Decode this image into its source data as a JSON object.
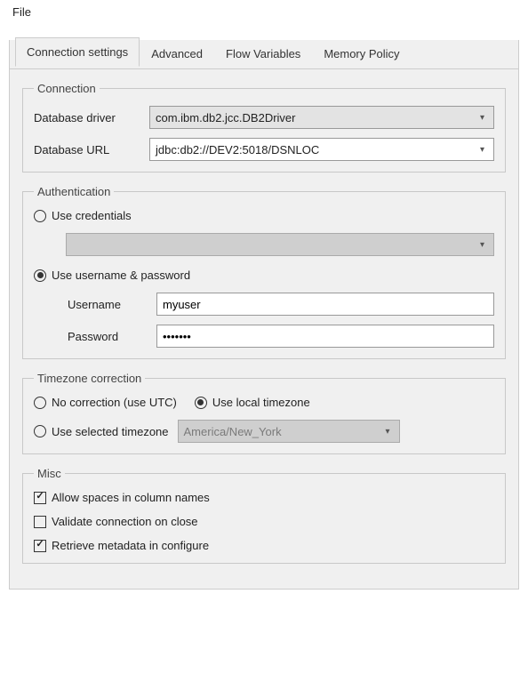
{
  "menu": {
    "file": "File"
  },
  "tabs": {
    "connection_settings": "Connection settings",
    "advanced": "Advanced",
    "flow_variables": "Flow Variables",
    "memory_policy": "Memory Policy"
  },
  "connection": {
    "legend": "Connection",
    "driver_label": "Database driver",
    "driver_value": "com.ibm.db2.jcc.DB2Driver",
    "url_label": "Database URL",
    "url_value": "jdbc:db2://DEV2:5018/DSNLOC"
  },
  "auth": {
    "legend": "Authentication",
    "use_credentials": "Use credentials",
    "use_username_password": "Use username & password",
    "username_label": "Username",
    "username_value": "myuser",
    "password_label": "Password",
    "password_value": "•••••••"
  },
  "timezone": {
    "legend": "Timezone correction",
    "no_correction": "No correction (use UTC)",
    "use_local": "Use local timezone",
    "use_selected": "Use selected timezone",
    "selected_value": "America/New_York"
  },
  "misc": {
    "legend": "Misc",
    "allow_spaces": "Allow spaces in column names",
    "validate_on_close": "Validate connection on close",
    "retrieve_metadata": "Retrieve metadata in configure"
  }
}
